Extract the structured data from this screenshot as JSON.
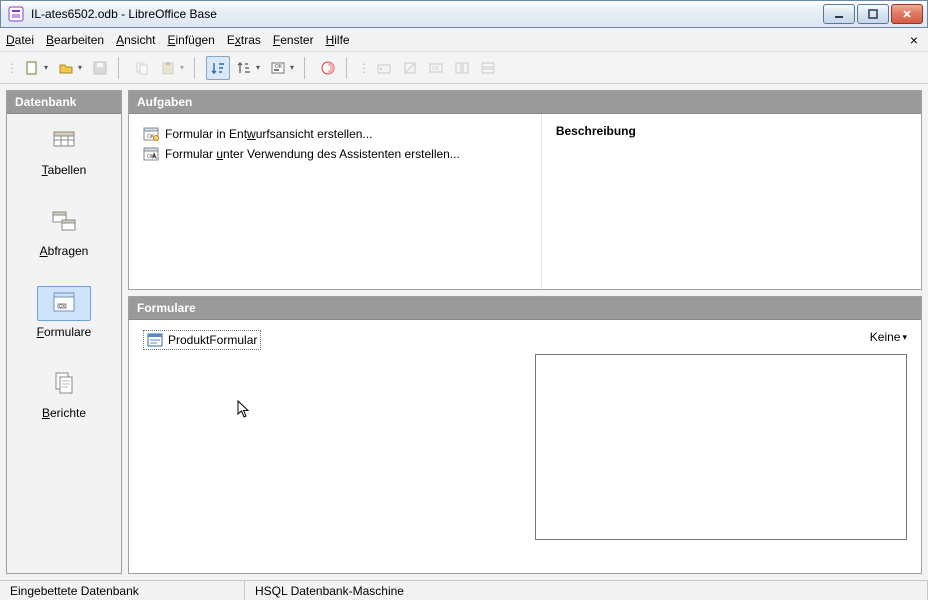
{
  "window": {
    "title": "IL-ates6502.odb - LibreOffice Base"
  },
  "menu": {
    "file": "Datei",
    "edit": "Bearbeiten",
    "view": "Ansicht",
    "insert": "Einfügen",
    "extras": "Extras",
    "window": "Fenster",
    "help": "Hilfe"
  },
  "sidebar": {
    "title": "Datenbank",
    "items": [
      {
        "label": "Tabellen"
      },
      {
        "label": "Abfragen"
      },
      {
        "label": "Formulare"
      },
      {
        "label": "Berichte"
      }
    ]
  },
  "tasks": {
    "title": "Aufgaben",
    "items": [
      {
        "label_pre": "Formular in Ent",
        "label_ul": "w",
        "label_post": "urfsansicht erstellen..."
      },
      {
        "label_pre": "Formular ",
        "label_ul": "u",
        "label_post": "nter Verwendung des Assistenten erstellen..."
      }
    ],
    "description_title": "Beschreibung"
  },
  "forms_section": {
    "title": "Formulare",
    "form_item": "ProduktFormular",
    "view_label": "Keine"
  },
  "status": {
    "left": "Eingebettete Datenbank",
    "center": "HSQL Datenbank-Maschine"
  }
}
